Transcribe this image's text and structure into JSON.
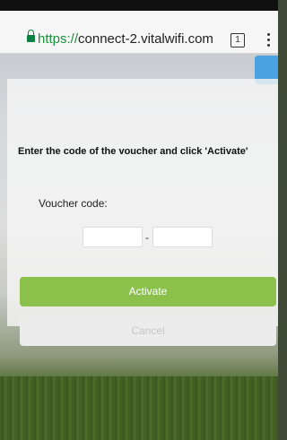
{
  "browser": {
    "url_scheme": "https://",
    "url_host": "connect-2.vitalwifi.com",
    "tab_count": "1"
  },
  "form": {
    "instruction": "Enter the code of the voucher and click 'Activate'",
    "voucher_label": "Voucher code:",
    "separator": "-",
    "activate_label": "Activate",
    "cancel_label": "Cancel"
  },
  "colors": {
    "lock": "#0b8043",
    "activate": "#8bc14a",
    "cancel": "#ececec",
    "accent_blue": "#4aa3df"
  }
}
